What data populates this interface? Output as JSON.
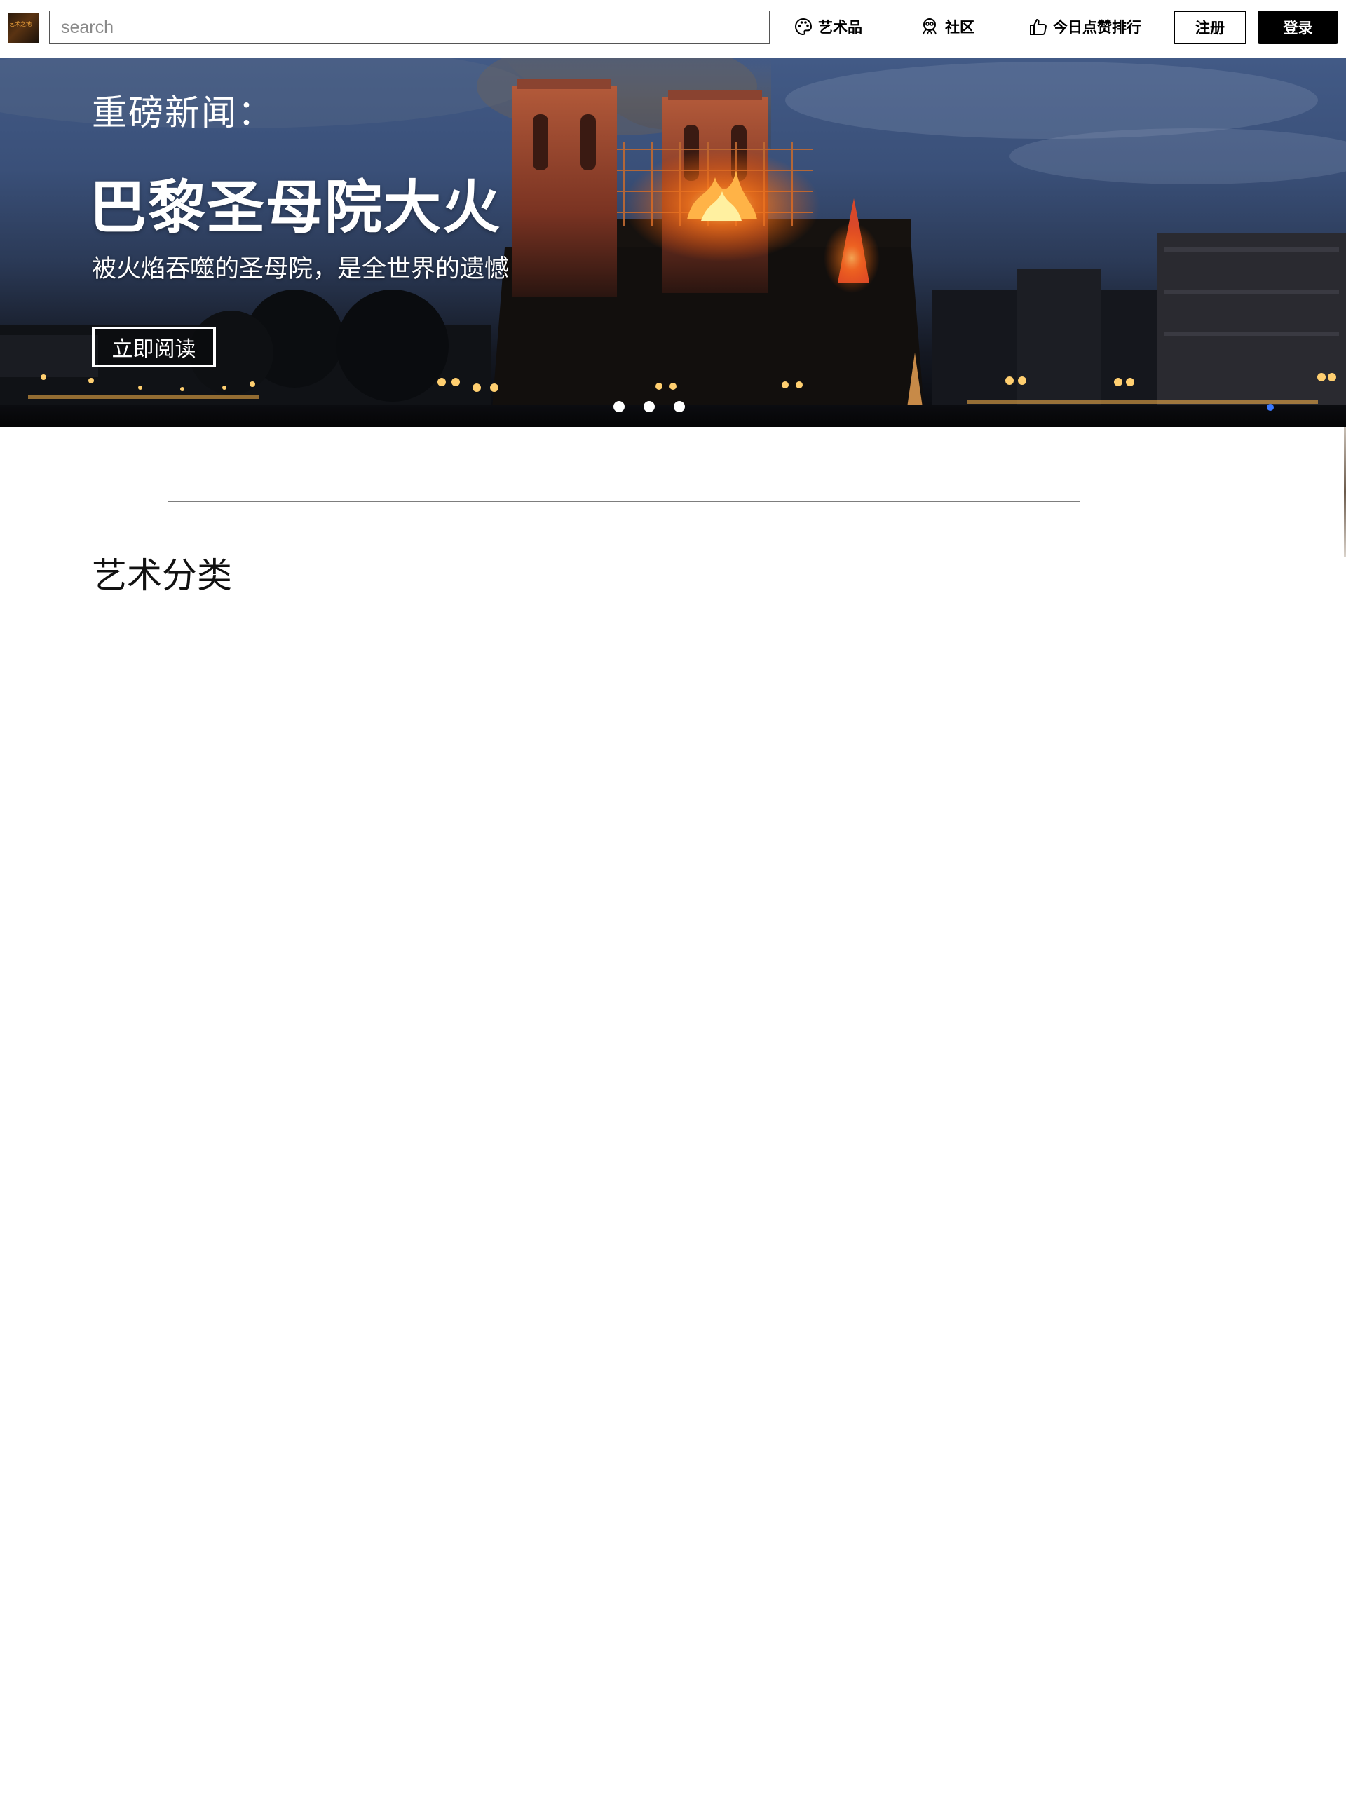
{
  "header": {
    "logo_text": "艺术之地",
    "search_placeholder": "search",
    "nav": [
      {
        "label": "艺术品",
        "icon": "palette-icon"
      },
      {
        "label": "社区",
        "icon": "community-icon"
      },
      {
        "label": "今日点赞排行",
        "icon": "thumbs-up-icon"
      }
    ],
    "register_label": "注册",
    "login_label": "登录"
  },
  "hero": {
    "kicker": "重磅新闻：",
    "title": "巴黎圣母院大火",
    "subtitle": "被火焰吞噬的圣母院，是全世界的遗憾",
    "read_button": "立即阅读",
    "slide_count": 3
  },
  "main": {
    "section_title": "艺术分类"
  },
  "colors": {
    "accent": "#000000",
    "fire": "#ff7a1a",
    "sky": "#3a5079"
  }
}
